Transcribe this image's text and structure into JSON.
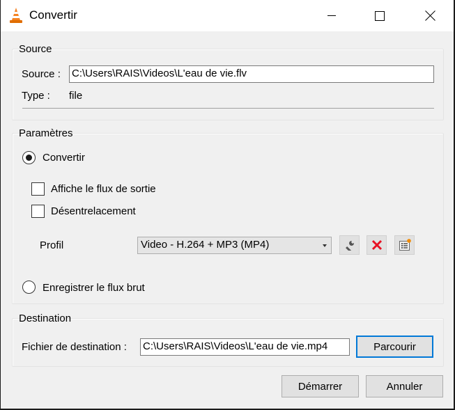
{
  "window": {
    "title": "Convertir",
    "icon": "vlc-cone-icon",
    "controls": {
      "minimize": "minimize-icon",
      "maximize": "maximize-icon",
      "close": "close-icon"
    }
  },
  "source": {
    "group_title": "Source",
    "source_label": "Source :",
    "source_value": "C:\\Users\\RAIS\\Videos\\L'eau de vie.flv",
    "type_label": "Type :",
    "type_value": "file"
  },
  "parameters": {
    "group_title": "Paramètres",
    "convert_radio": {
      "label": "Convertir",
      "checked": true
    },
    "show_output": {
      "label": "Affiche le flux de sortie",
      "checked": false
    },
    "deinterlace": {
      "label": "Désentrelacement",
      "checked": false
    },
    "profile_label": "Profil",
    "profile_selected": "Video - H.264 + MP3 (MP4)",
    "profile_tools": [
      {
        "name": "edit-profile",
        "icon": "wrench-icon"
      },
      {
        "name": "delete-profile",
        "icon": "red-x-icon"
      },
      {
        "name": "new-profile",
        "icon": "new-list-icon"
      }
    ],
    "raw_dump_radio": {
      "label": "Enregistrer le flux brut",
      "checked": false
    }
  },
  "destination": {
    "group_title": "Destination",
    "file_label": "Fichier de destination :",
    "file_value": "C:\\Users\\RAIS\\Videos\\L'eau de vie.mp4",
    "browse_label": "Parcourir"
  },
  "footer": {
    "start_label": "Démarrer",
    "cancel_label": "Annuler"
  },
  "colors": {
    "accent": "#0078d7",
    "delete_red": "#e81123",
    "vlc_orange": "#f08a00"
  }
}
